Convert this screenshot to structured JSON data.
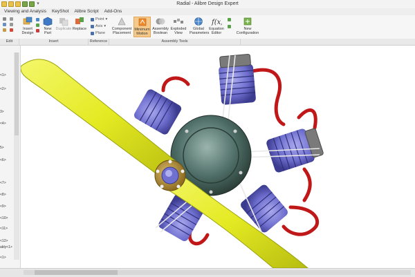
{
  "window": {
    "title": "Radial - Alibre Design Expert"
  },
  "menu": [
    "Viewing and Analysis",
    "KeyShot",
    "Alibre Script",
    "Add-Ons"
  ],
  "ribbon": {
    "buttons": {
      "insert_design": "Insert Design",
      "new_part": "New Part",
      "duplicate": "Duplicate",
      "replace": "Replace",
      "component_placement": "Component Placement",
      "minimum_motion": "Minimum Motion",
      "assembly_boolean": "Assembly Boolean",
      "exploded_view": "Exploded View",
      "global_parameters": "Global Parameters",
      "equation_editor": "Equation Editor",
      "new_configuration": "New Configuration"
    },
    "small": {
      "point": "Point",
      "axis": "Axis",
      "plane": "Plane"
    },
    "groups": [
      "Edit",
      "Insert",
      "Reference",
      "Assembly Tools"
    ]
  },
  "sidebar_labels": [
    "<1>",
    "<2>",
    "3>",
    "<4>",
    "5>",
    "<6>",
    "<7>",
    "<8>",
    "<9>",
    "<10>",
    "<11>",
    "<12>",
    "<12>",
    "ably<1>",
    "<1>"
  ],
  "colors": {
    "propeller": "#e9ef2b",
    "cylinder": "#6f6fcf",
    "exhaust": "#c01818",
    "crankcase": "#3f5b55",
    "active_button": "#f5c98a"
  }
}
